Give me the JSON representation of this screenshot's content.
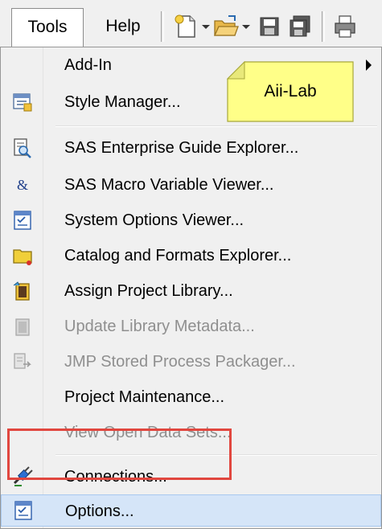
{
  "menubar": {
    "tools_label": "Tools",
    "help_label": "Help",
    "toolbar": {
      "new_icon": "new-document-icon",
      "open_icon": "open-folder-icon",
      "save_icon": "save-icon",
      "save_all_icon": "save-all-icon",
      "print_icon": "print-icon"
    }
  },
  "tools_menu": {
    "items": [
      {
        "label": "Add-In",
        "icon": null,
        "disabled": false,
        "submenu": true
      },
      {
        "label": "Style Manager...",
        "icon": "style-manager-icon",
        "disabled": false
      },
      {
        "label": "SAS Enterprise Guide Explorer...",
        "icon": "explorer-icon",
        "disabled": false
      },
      {
        "label": "SAS Macro Variable Viewer...",
        "icon": "ampersand-icon",
        "disabled": false
      },
      {
        "label": "System Options Viewer...",
        "icon": "options-viewer-icon",
        "disabled": false
      },
      {
        "label": "Catalog and Formats Explorer...",
        "icon": "folder-icon",
        "disabled": false
      },
      {
        "label": "Assign Project Library...",
        "icon": "library-icon",
        "disabled": false
      },
      {
        "label": "Update Library Metadata...",
        "icon": "library-metadata-icon",
        "disabled": true
      },
      {
        "label": "JMP Stored Process Packager...",
        "icon": "packager-icon",
        "disabled": true
      },
      {
        "label": "Project Maintenance...",
        "icon": null,
        "disabled": false
      },
      {
        "label": "View Open Data Sets...",
        "icon": null,
        "disabled": true
      },
      {
        "label": "Connections...",
        "icon": "connections-icon",
        "disabled": false
      },
      {
        "label": "Options...",
        "icon": "options-icon",
        "disabled": false,
        "highlighted": true
      }
    ]
  },
  "sticky_note": {
    "text": "Aii-Lab"
  },
  "colors": {
    "highlight_border": "#e1473f",
    "sticky_fill": "#ffff88",
    "hover_fill": "#d5e5f8"
  }
}
